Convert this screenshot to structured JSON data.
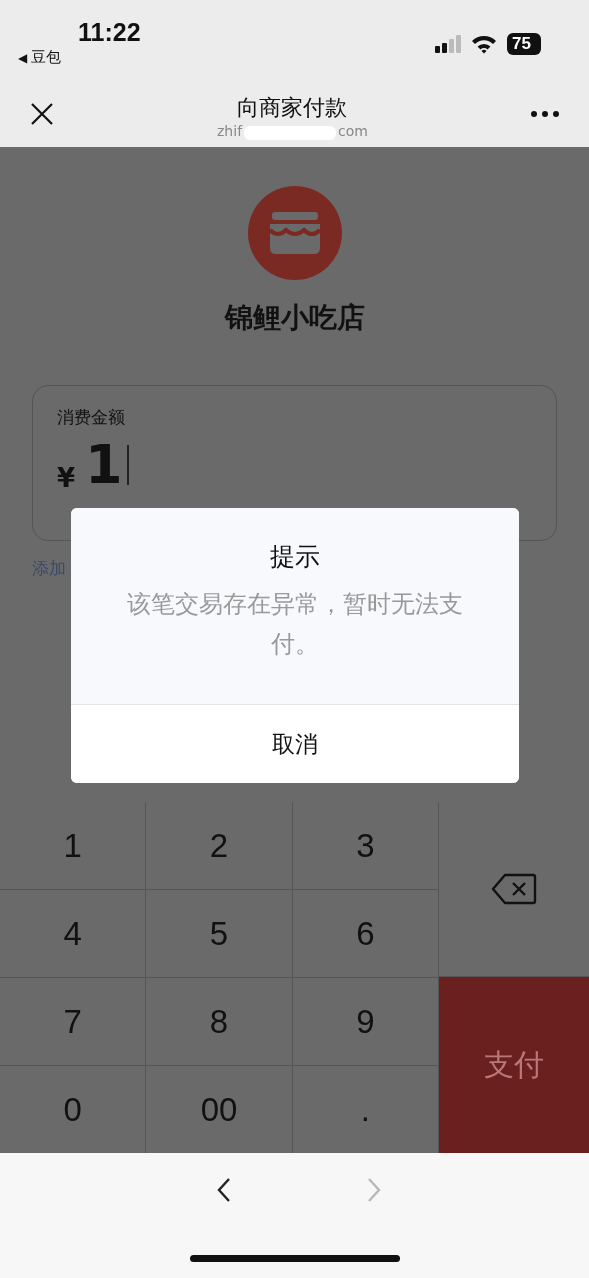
{
  "status_bar": {
    "time": "11:22",
    "back_arrow": "◀",
    "back_app": "豆包",
    "battery": "75"
  },
  "nav": {
    "title": "向商家付款",
    "url_start": "zhif",
    "url_end": "com"
  },
  "merchant": {
    "name": "锦鲤小吃店"
  },
  "amount": {
    "label": "消费金额",
    "currency": "¥",
    "value": "1"
  },
  "add_note": "添加",
  "dialog": {
    "title": "提示",
    "message": "该笔交易存在异常，暂时无法支付。",
    "buttons": [
      "取消"
    ]
  },
  "keypad": {
    "keys": [
      "1",
      "2",
      "3",
      "4",
      "5",
      "6",
      "7",
      "8",
      "9",
      "0",
      "00",
      "."
    ],
    "pay": "支付"
  },
  "browser_bar": [
    {
      "kind": "back",
      "disabled": false
    },
    {
      "kind": "forward",
      "disabled": true
    }
  ]
}
